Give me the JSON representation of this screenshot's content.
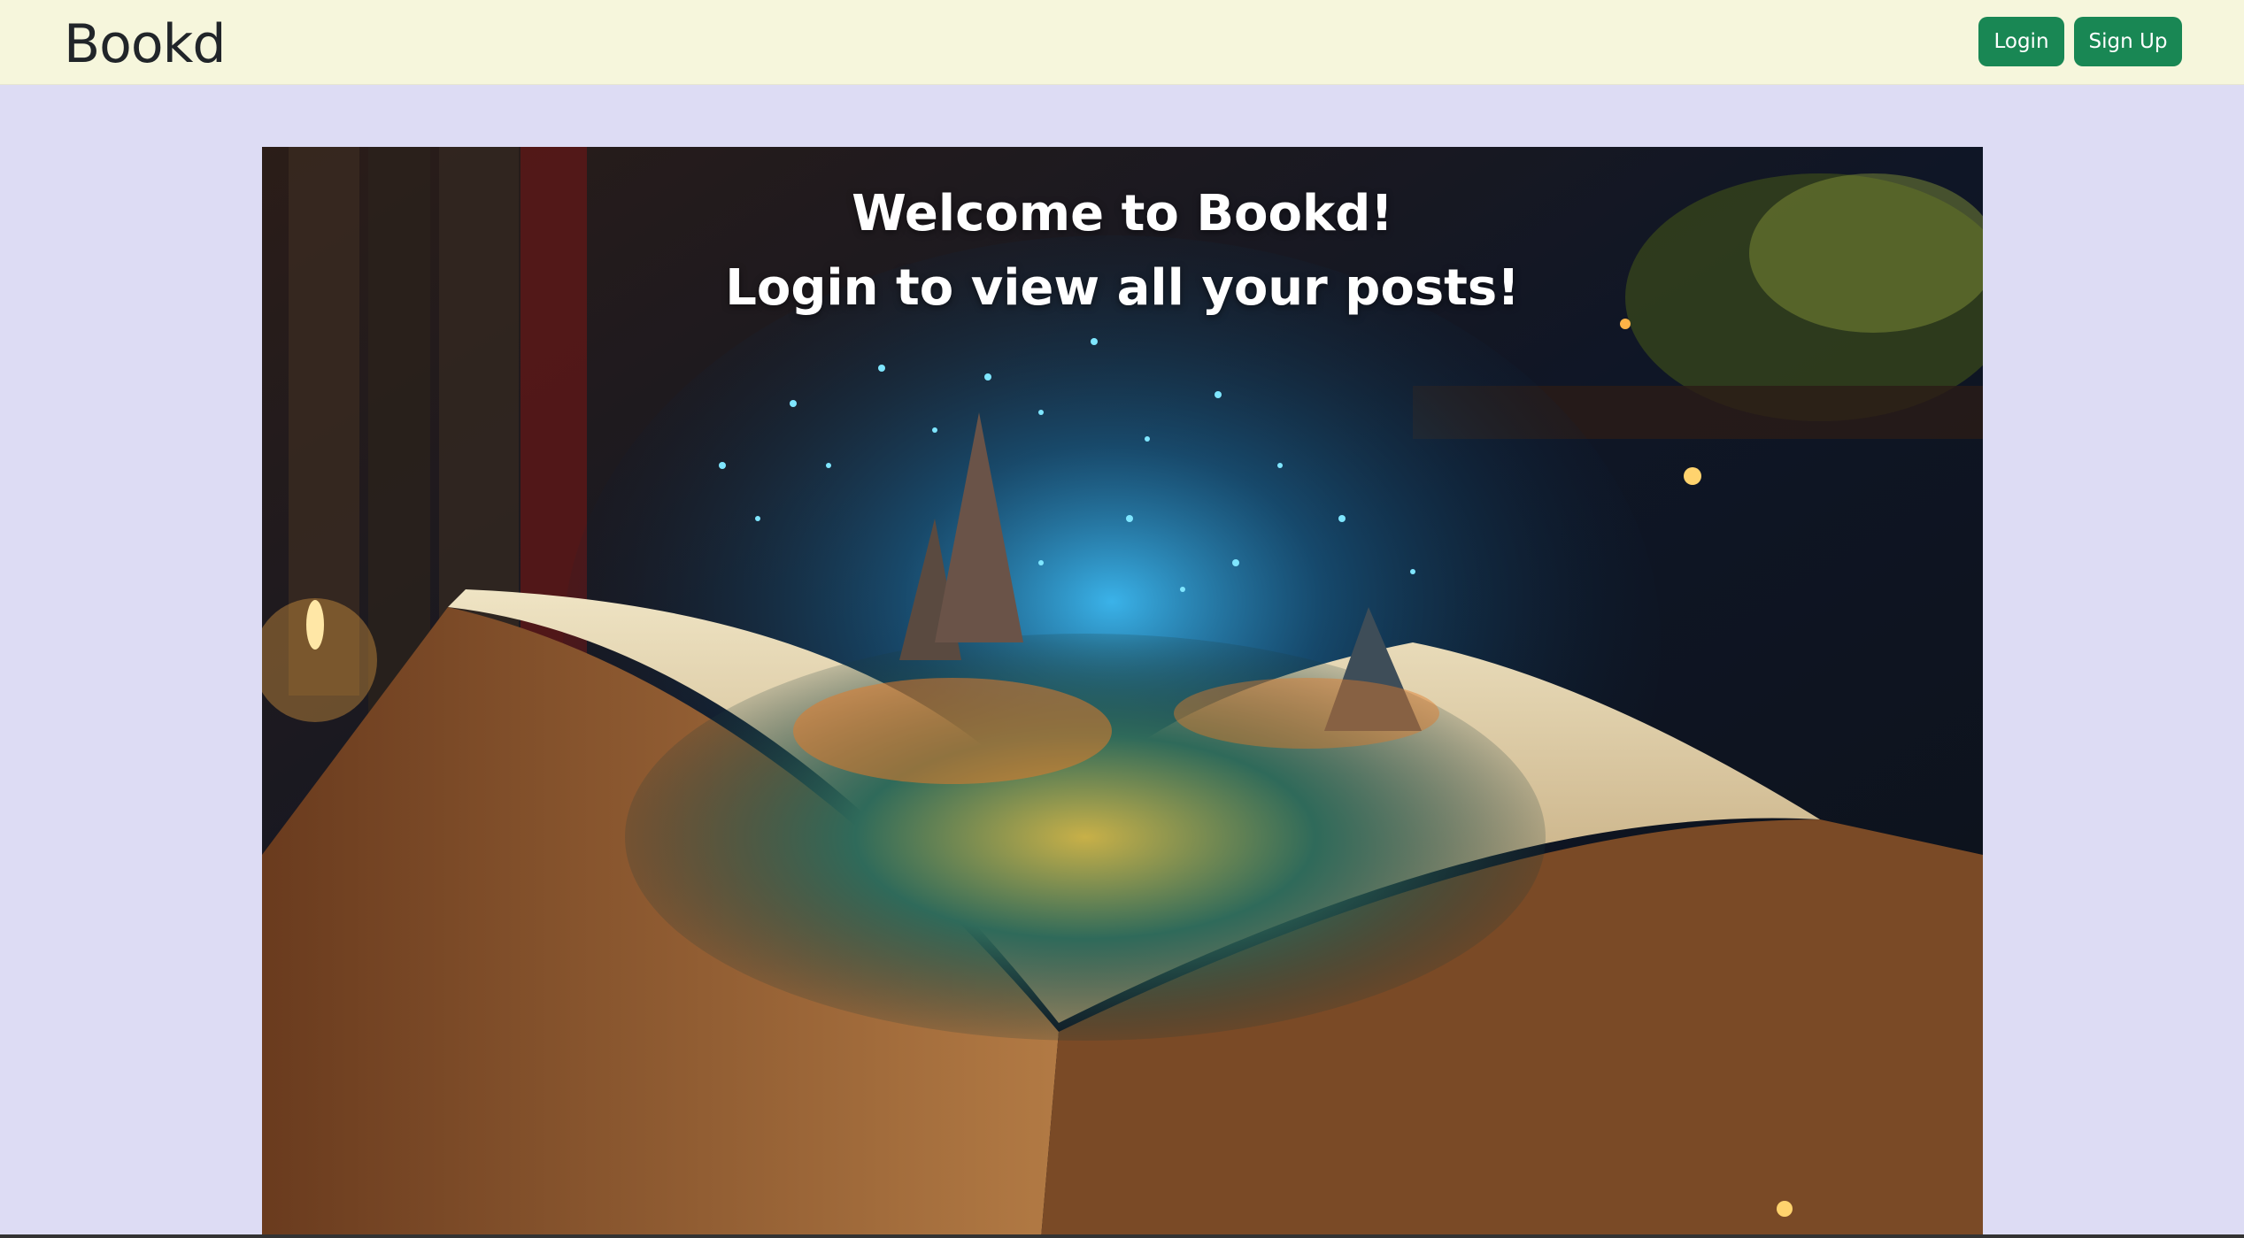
{
  "navbar": {
    "brand": "Bookd",
    "login_label": "Login",
    "signup_label": "Sign Up"
  },
  "hero": {
    "title": "Welcome to Bookd!",
    "subtitle": "Login to view all your posts!",
    "image_icon": "open-magic-book-illustration"
  },
  "colors": {
    "page_bg": "#dddcf4",
    "navbar_bg": "#f6f6dc",
    "button_bg": "#198754",
    "button_text": "#ffffff",
    "brand_text": "#212529"
  }
}
